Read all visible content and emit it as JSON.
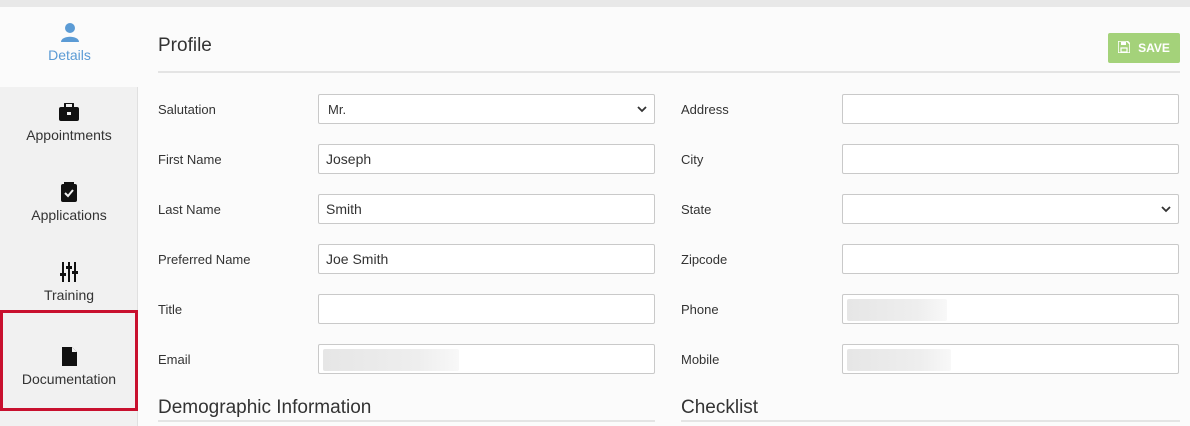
{
  "sidebar": {
    "items": [
      {
        "label": "Details",
        "icon": "user-icon"
      },
      {
        "label": "Appointments",
        "icon": "briefcase-icon"
      },
      {
        "label": "Applications",
        "icon": "check-square-icon"
      },
      {
        "label": "Training",
        "icon": "sliders-icon"
      },
      {
        "label": "Documentation",
        "icon": "file-icon"
      }
    ],
    "active_color": "#5b9bd5",
    "highlight_color": "#c8102e"
  },
  "profile": {
    "title": "Profile",
    "save_label": "SAVE",
    "save_color": "#a4d27a"
  },
  "form": {
    "salutation": {
      "label": "Salutation",
      "value": "Mr."
    },
    "first_name": {
      "label": "First Name",
      "value": "Joseph"
    },
    "last_name": {
      "label": "Last Name",
      "value": "Smith"
    },
    "preferred_name": {
      "label": "Preferred Name",
      "value": "Joe Smith"
    },
    "title": {
      "label": "Title",
      "value": ""
    },
    "email": {
      "label": "Email",
      "value": ""
    },
    "address": {
      "label": "Address",
      "value": ""
    },
    "city": {
      "label": "City",
      "value": ""
    },
    "state": {
      "label": "State",
      "value": ""
    },
    "zipcode": {
      "label": "Zipcode",
      "value": ""
    },
    "phone": {
      "label": "Phone",
      "value": ""
    },
    "mobile": {
      "label": "Mobile",
      "value": ""
    }
  },
  "sections": {
    "demographic": "Demographic Information",
    "checklist": "Checklist"
  }
}
